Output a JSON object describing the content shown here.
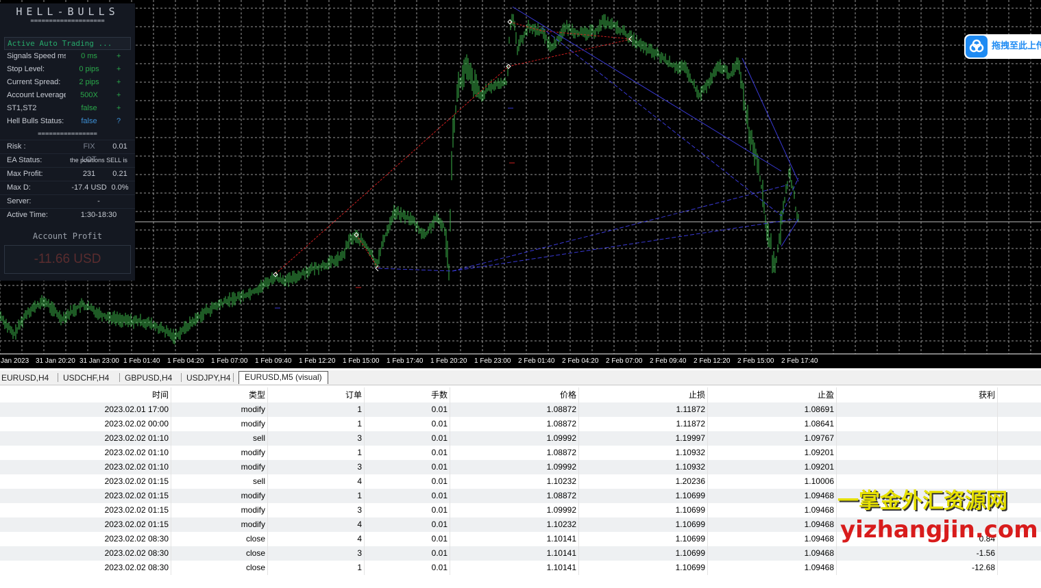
{
  "ea_panel": {
    "title": "HELL-BULLS",
    "separator_top": "====================",
    "active_label": "Active Auto Trading ...",
    "status_rows": [
      {
        "label": "Signals Speed ms",
        "value": "0 ms",
        "mark": "+"
      },
      {
        "label": "Stop Level:",
        "value": "0 pips",
        "mark": "+"
      },
      {
        "label": "Current Spread:",
        "value": "2 pips",
        "mark": "+"
      },
      {
        "label": "Account Leverage:",
        "value": "500X",
        "mark": "+"
      },
      {
        "label": "ST1,ST2",
        "value": "false",
        "mark": "+"
      },
      {
        "label": "Hell Bulls Status:",
        "value": "false",
        "mark": "?"
      }
    ],
    "separator_mid": "================",
    "risk": {
      "label": "Risk :",
      "mode": "FIX LOT",
      "lot": "0.01"
    },
    "ea_status": {
      "label": "EA Status:",
      "value": "the positions SELL is"
    },
    "max_profit": {
      "label": "Max Profit:",
      "value": "231",
      "value2": "0.21"
    },
    "max_dd": {
      "label": "Max D:",
      "value": "-17.4 USD",
      "value2": "0.0%"
    },
    "server": {
      "label": "Server:",
      "value": "-"
    },
    "active_time": {
      "label": "Active Time:",
      "value": "1:30-18:30"
    },
    "account_profit_label": "Account Profit",
    "account_profit_value": "-11.66 USD"
  },
  "upload_button": {
    "label": "拖拽至此上传",
    "icon": "cloud-upload-icon"
  },
  "time_axis": [
    "Jan 2023",
    "31 Jan 20:20",
    "31 Jan 23:00",
    "1 Feb 01:40",
    "1 Feb 04:20",
    "1 Feb 07:00",
    "1 Feb 09:40",
    "1 Feb 12:20",
    "1 Feb 15:00",
    "1 Feb 17:40",
    "1 Feb 20:20",
    "1 Feb 23:00",
    "2 Feb 01:40",
    "2 Feb 04:20",
    "2 Feb 07:00",
    "2 Feb 09:40",
    "2 Feb 12:20",
    "2 Feb 15:00",
    "2 Feb 17:40"
  ],
  "tabs": [
    "EURUSD,H4",
    "USDCHF,H4",
    "GBPUSD,H4",
    "USDJPY,H4",
    "EURUSD,M5 (visual)"
  ],
  "active_tab": "EURUSD,M5 (visual)",
  "table": {
    "headers": [
      "时间",
      "类型",
      "订单",
      "手数",
      "价格",
      "止损",
      "止盈",
      "获利"
    ],
    "rows": [
      [
        "2023.02.01 17:00",
        "modify",
        "1",
        "0.01",
        "1.08872",
        "1.11872",
        "1.08691",
        ""
      ],
      [
        "2023.02.02 00:00",
        "modify",
        "1",
        "0.01",
        "1.08872",
        "1.11872",
        "1.08641",
        ""
      ],
      [
        "2023.02.02 01:10",
        "sell",
        "3",
        "0.01",
        "1.09992",
        "1.19997",
        "1.09767",
        ""
      ],
      [
        "2023.02.02 01:10",
        "modify",
        "1",
        "0.01",
        "1.08872",
        "1.10932",
        "1.09201",
        ""
      ],
      [
        "2023.02.02 01:10",
        "modify",
        "3",
        "0.01",
        "1.09992",
        "1.10932",
        "1.09201",
        ""
      ],
      [
        "2023.02.02 01:15",
        "sell",
        "4",
        "0.01",
        "1.10232",
        "1.20236",
        "1.10006",
        ""
      ],
      [
        "2023.02.02 01:15",
        "modify",
        "1",
        "0.01",
        "1.08872",
        "1.10699",
        "1.09468",
        ""
      ],
      [
        "2023.02.02 01:15",
        "modify",
        "3",
        "0.01",
        "1.09992",
        "1.10699",
        "1.09468",
        ""
      ],
      [
        "2023.02.02 01:15",
        "modify",
        "4",
        "0.01",
        "1.10232",
        "1.10699",
        "1.09468",
        ""
      ],
      [
        "2023.02.02 08:30",
        "close",
        "4",
        "0.01",
        "1.10141",
        "1.10699",
        "1.09468",
        "0.84"
      ],
      [
        "2023.02.02 08:30",
        "close",
        "3",
        "0.01",
        "1.10141",
        "1.10699",
        "1.09468",
        "-1.56"
      ],
      [
        "2023.02.02 08:30",
        "close",
        "1",
        "0.01",
        "1.10141",
        "1.10699",
        "1.09468",
        "-12.68"
      ]
    ]
  },
  "watermark": {
    "line1": "一掌金外汇资源网",
    "line2": "yizhangjin.com"
  },
  "colors": {
    "candle": "#3bb54a",
    "trend_red": "#d02020",
    "trend_blue": "#3a3ad8",
    "grid": "#c0c0c0",
    "background": "#000000"
  }
}
